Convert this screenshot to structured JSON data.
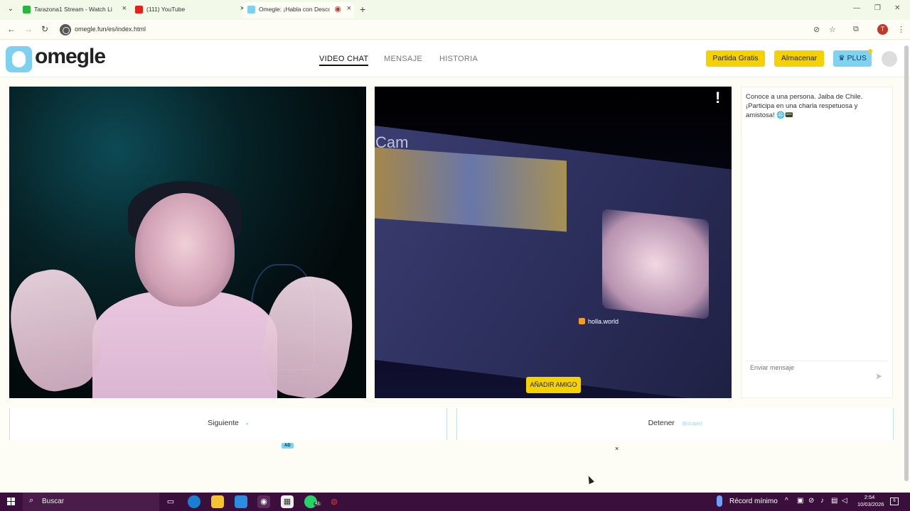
{
  "browser": {
    "tabs": [
      {
        "title": "Tarazona1 Stream - Watch Live",
        "favicon_color": "#2ab53c",
        "active": false
      },
      {
        "title": "(111) YouTube",
        "favicon_color": "#e62117",
        "active": false
      },
      {
        "title": "Omegle: ¡Habla con Desco",
        "favicon_color": "#7ed0f0",
        "active": true
      }
    ],
    "url": "omegle.fun/es/index.html",
    "profile_initial": "T"
  },
  "site": {
    "logo_text": "omegle",
    "nav": [
      {
        "label": "VIDEO CHAT",
        "active": true
      },
      {
        "label": "MENSAJE",
        "active": false
      },
      {
        "label": "HISTORIA",
        "active": false
      }
    ],
    "buttons": {
      "free_game": "Partida Gratis",
      "store": "Almacenar",
      "plus": "♛ PLUS"
    },
    "colors": {
      "yellow": "#f6d100",
      "accent_blue": "#7fd3f0"
    }
  },
  "video": {
    "remote_overlay_cam": "Cam",
    "remote_overlay_brand": "holla.world",
    "report_glyph": "!",
    "add_friend": "AÑADIR AMIGO"
  },
  "chat": {
    "intro": "Conoce a una persona. Jaiba de Chile. ¡Participa en una charla respetuosa y amistosa! 🌐📟",
    "input_placeholder": "Enviar mensaje",
    "send_icon": "send-icon"
  },
  "controls": {
    "next_label": "Siguiente",
    "next_hint": "▸",
    "stop_label": "Detener",
    "stop_hint": "(Escape)"
  },
  "ad": {
    "badge": "AD",
    "close": "×"
  },
  "taskbar": {
    "search_label": "Buscar",
    "whatsapp_badge": "41",
    "weather_text": "Récord mínimo",
    "time": "2:54",
    "date": "10/03/2026",
    "notifications": "6"
  }
}
